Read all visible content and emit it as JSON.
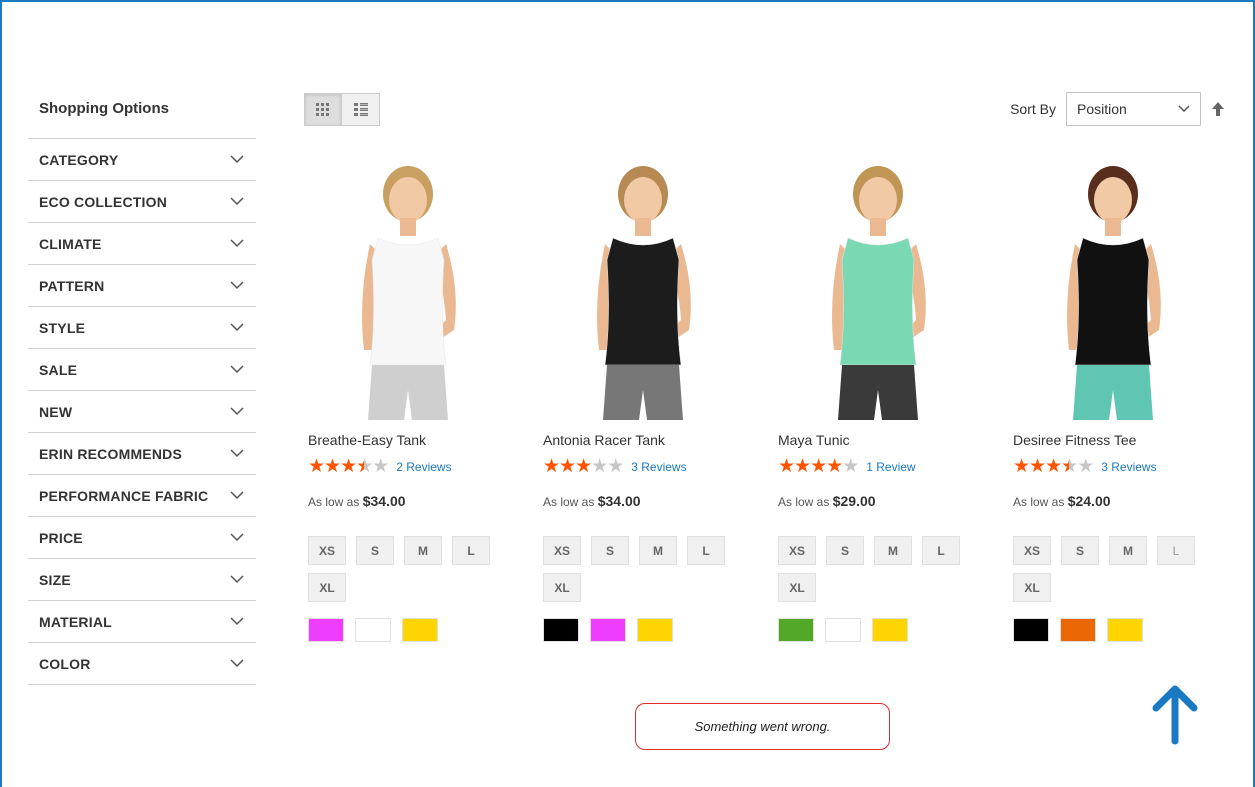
{
  "sidebar": {
    "title": "Shopping Options",
    "filters": [
      {
        "label": "CATEGORY"
      },
      {
        "label": "ECO COLLECTION"
      },
      {
        "label": "CLIMATE"
      },
      {
        "label": "PATTERN"
      },
      {
        "label": "STYLE"
      },
      {
        "label": "SALE"
      },
      {
        "label": "NEW"
      },
      {
        "label": "ERIN RECOMMENDS"
      },
      {
        "label": "PERFORMANCE FABRIC"
      },
      {
        "label": "PRICE"
      },
      {
        "label": "SIZE"
      },
      {
        "label": "MATERIAL"
      },
      {
        "label": "COLOR"
      }
    ]
  },
  "toolbar": {
    "modes": [
      "grid-icon",
      "list-icon"
    ],
    "active_mode": "grid",
    "sort_label": "Sort By",
    "sort_value": "Position",
    "sort_direction_icon": "arrow-up-icon"
  },
  "products": [
    {
      "name": "Breathe-Easy Tank",
      "rating": 3.5,
      "reviews": "2  Reviews",
      "price_prefix": "As low as",
      "price": "$34.00",
      "sizes": [
        "XS",
        "S",
        "M",
        "L",
        "XL"
      ],
      "colors": [
        "#ef3dff",
        "#ffffff",
        "#ffd500"
      ],
      "shirt_color": "#f7f7f7",
      "bottom_color": "#cfcfcf",
      "hair_color": "#c9a062"
    },
    {
      "name": "Antonia Racer Tank",
      "rating": 3,
      "reviews": "3  Reviews",
      "price_prefix": "As low as",
      "price": "$34.00",
      "sizes": [
        "XS",
        "S",
        "M",
        "L",
        "XL"
      ],
      "colors": [
        "#000000",
        "#ef3dff",
        "#ffd500"
      ],
      "shirt_color": "#1c1c1c",
      "bottom_color": "#777777",
      "hair_color": "#b68a52"
    },
    {
      "name": "Maya Tunic",
      "rating": 4,
      "reviews": "1  Review",
      "price_prefix": "As low as",
      "price": "$29.00",
      "sizes": [
        "XS",
        "S",
        "M",
        "L",
        "XL"
      ],
      "colors": [
        "#53a828",
        "#ffffff",
        "#ffd500"
      ],
      "shirt_color": "#7ad8b3",
      "bottom_color": "#3a3a3a",
      "hair_color": "#c09555"
    },
    {
      "name": "Desiree Fitness Tee",
      "rating": 3.5,
      "reviews": "3  Reviews",
      "price_prefix": "As low as",
      "price": "$24.00",
      "sizes": [
        "XS",
        "S",
        "M",
        "L",
        "XL"
      ],
      "colors": [
        "#000000",
        "#eb6703",
        "#ffd500"
      ],
      "shirt_color": "#111111",
      "bottom_color": "#5fc6b4",
      "hair_color": "#5a2e1c"
    }
  ],
  "error_message": "Something went wrong.",
  "colors": {
    "accent": "#1979c3",
    "star": "#ff5501",
    "error_border": "#e02b27"
  }
}
